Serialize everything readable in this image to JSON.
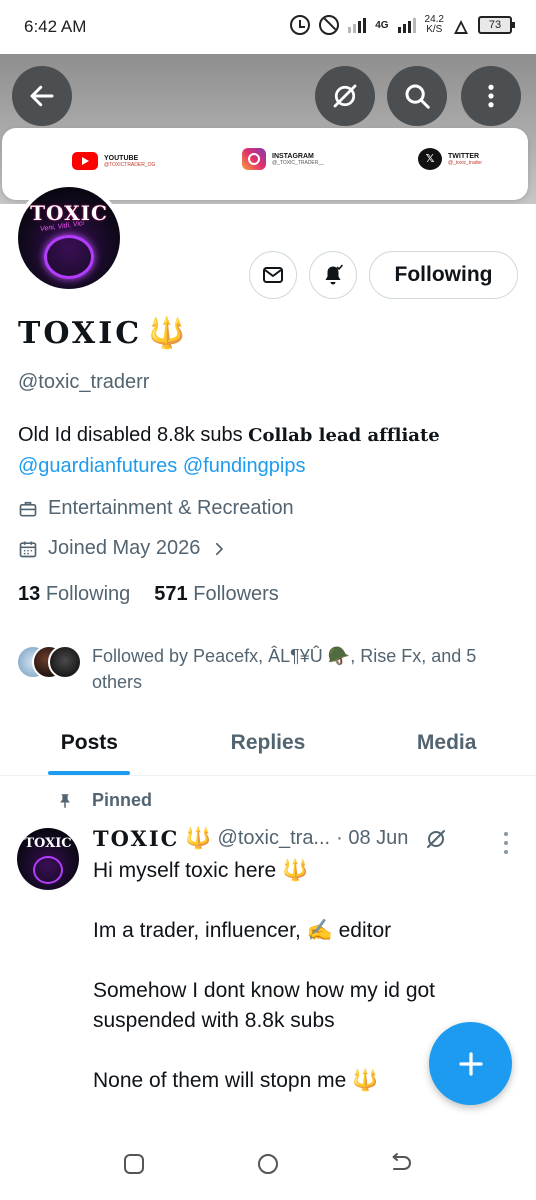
{
  "status_bar": {
    "time": "6:42 AM",
    "network": "4G",
    "speed_value": "24.2",
    "speed_unit": "K/S",
    "battery": "73",
    "icons": [
      "alarm-icon",
      "do-not-disturb-icon",
      "signal-icon",
      "signal-icon",
      "flask-icon",
      "battery-icon"
    ]
  },
  "banner": {
    "socials": [
      {
        "platform": "YOUTUBE",
        "handle": "@TOXICTRADER_OG",
        "icon": "youtube-icon"
      },
      {
        "platform": "INSTAGRAM",
        "handle": "@_TOXIC_TRADER__",
        "icon": "instagram-icon"
      },
      {
        "platform": "TWITTER",
        "handle": "@_toxic_trader",
        "icon": "x-icon"
      }
    ]
  },
  "top_actions": {
    "icons": [
      "back-arrow-icon",
      "grok-icon",
      "search-icon",
      "more-vertical-icon"
    ]
  },
  "profile": {
    "avatar_text": "TOXIC",
    "avatar_tagline": "Veni, Vidi, Vici",
    "follow_button": "Following",
    "display_name": "TOXIC",
    "name_emoji": "🔱",
    "handle": "@toxic_traderr",
    "bio_plain": "Old Id disabled 8.8k subs ",
    "bio_styled": "𝐂𝐨𝐥𝐥𝐚𝐛 𝐥𝐞𝐚𝐝 𝐚𝐟𝐟𝐥𝐢𝐚𝐭𝐞",
    "bio_link_1": "@guardianfutures",
    "bio_link_2": "@fundingpips",
    "category": "Entertainment & Recreation",
    "joined": "Joined May 2026",
    "following_count": "13",
    "following_label": "Following",
    "followers_count": "571",
    "followers_label": "Followers",
    "followed_by": "Followed by Peacefx, ÂL¶¥Û 🪖, Rise Fx, and 5 others"
  },
  "tabs": [
    {
      "label": "Posts",
      "active": true
    },
    {
      "label": "Replies",
      "active": false
    },
    {
      "label": "Media",
      "active": false
    }
  ],
  "post": {
    "pinned_label": "Pinned",
    "author_name": "TOXIC",
    "author_emoji": "🔱",
    "author_handle": "@toxic_tra...",
    "date": "· 08 Jun",
    "lines": [
      "Hi myself toxic here 🔱",
      "Im a trader, influencer, ✍️ editor",
      "Somehow I dont know how my id got suspended with 8.8k subs",
      "None of them will stopn me 🔱"
    ]
  },
  "fab": {
    "icon": "plus-icon"
  },
  "nav_bar": {
    "icons": [
      "recents-square-icon",
      "home-circle-icon",
      "back-icon"
    ]
  },
  "colors": {
    "accent": "#1d9bf0",
    "trident": "#f2a416",
    "muted": "#536471",
    "text": "#0f1419"
  }
}
